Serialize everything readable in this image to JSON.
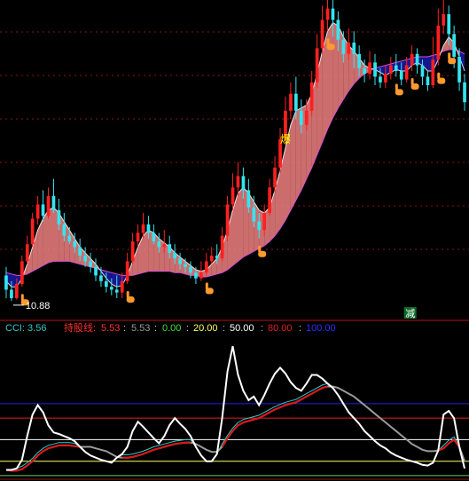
{
  "colors": {
    "background": "#000000",
    "up_candle": "#ff2020",
    "down_candle": "#33e5f0",
    "ribbon_up": "#f08080",
    "ribbon_down": "#1a1aa6",
    "ma_long": "#d94fd9",
    "ma_short": "#ffffff",
    "grid_red": "#8a1818",
    "separator": "#b01818",
    "cci": "#ffffff",
    "hold_line": "#e01414",
    "hold_grey": "#9a9a9a",
    "thin_cyan": "#33c8c8",
    "level_20": "#ffff66",
    "level_0": "#66cc66",
    "level_50": "#ffffff",
    "level_80": "#e02020",
    "level_100": "#2020ee",
    "hand": "#ff9a2e"
  },
  "main_panel": {
    "low_price_label": "10.88",
    "burst_label": "爆",
    "reduce_label": "减",
    "grid_rows": 6
  },
  "indicator_panel": {
    "cci_label": "CCI: 3.56",
    "hold_line_label": "持股线:",
    "hold_values": [
      "5.53",
      "5.53"
    ],
    "levels": [
      "0.00",
      "20.00",
      "50.00",
      "80.00",
      "100.00"
    ]
  },
  "chart_data": [
    {
      "type": "candlestick",
      "title": "",
      "low_marker_price": 10.88,
      "ylim": [
        10.5,
        21.5
      ],
      "candles": [
        [
          11.8,
          11.3,
          12.1,
          11.0
        ],
        [
          11.3,
          11.0,
          11.6,
          10.9
        ],
        [
          11.0,
          11.5,
          11.7,
          10.95
        ],
        [
          11.5,
          12.3,
          12.5,
          11.4
        ],
        [
          12.3,
          12.9,
          13.2,
          12.2
        ],
        [
          12.9,
          13.8,
          14.0,
          12.8
        ],
        [
          13.8,
          14.3,
          14.6,
          13.6
        ],
        [
          14.3,
          13.9,
          14.8,
          13.7
        ],
        [
          13.9,
          14.6,
          14.9,
          13.8
        ],
        [
          14.6,
          14.1,
          15.2,
          14.0
        ],
        [
          14.1,
          13.6,
          14.5,
          13.4
        ],
        [
          13.6,
          13.2,
          14.0,
          13.0
        ],
        [
          13.2,
          13.0,
          13.5,
          12.9
        ],
        [
          13.0,
          12.8,
          13.3,
          12.6
        ],
        [
          12.8,
          12.5,
          13.1,
          12.3
        ],
        [
          12.5,
          12.3,
          12.8,
          12.1
        ],
        [
          12.3,
          12.1,
          12.6,
          11.9
        ],
        [
          12.1,
          11.8,
          12.4,
          11.6
        ],
        [
          11.8,
          11.6,
          12.1,
          11.4
        ],
        [
          11.6,
          11.4,
          11.9,
          11.2
        ],
        [
          11.4,
          11.3,
          11.7,
          11.1
        ],
        [
          11.3,
          11.2,
          11.8,
          11.0
        ],
        [
          11.2,
          11.6,
          11.9,
          11.0
        ],
        [
          11.6,
          12.3,
          12.6,
          11.5
        ],
        [
          12.3,
          13.0,
          13.3,
          12.2
        ],
        [
          13.0,
          13.3,
          13.6,
          12.8
        ],
        [
          13.3,
          13.6,
          14.0,
          13.1
        ],
        [
          13.6,
          13.3,
          13.9,
          13.1
        ],
        [
          13.3,
          13.0,
          13.6,
          12.9
        ],
        [
          13.0,
          12.8,
          13.3,
          12.6
        ],
        [
          12.8,
          12.9,
          13.4,
          12.6
        ],
        [
          12.9,
          12.6,
          13.2,
          12.4
        ],
        [
          12.6,
          12.4,
          12.9,
          12.2
        ],
        [
          12.4,
          12.2,
          12.6,
          12.0
        ],
        [
          12.2,
          12.1,
          12.4,
          11.9
        ],
        [
          12.1,
          11.9,
          12.3,
          11.7
        ],
        [
          11.9,
          11.7,
          12.1,
          11.5
        ],
        [
          11.7,
          11.9,
          12.3,
          11.6
        ],
        [
          11.9,
          12.3,
          12.6,
          11.8
        ],
        [
          12.3,
          12.5,
          12.8,
          12.2
        ],
        [
          12.5,
          12.4,
          12.9,
          12.2
        ],
        [
          12.4,
          13.2,
          13.5,
          12.3
        ],
        [
          13.2,
          14.3,
          14.6,
          13.0
        ],
        [
          14.3,
          14.9,
          15.4,
          14.1
        ],
        [
          14.9,
          15.3,
          15.8,
          14.6
        ],
        [
          15.3,
          14.8,
          15.6,
          14.5
        ],
        [
          14.8,
          14.2,
          15.2,
          14.0
        ],
        [
          14.2,
          13.7,
          14.6,
          13.5
        ],
        [
          13.7,
          13.4,
          14.0,
          13.1
        ],
        [
          13.4,
          14.0,
          14.3,
          13.2
        ],
        [
          14.0,
          14.9,
          15.2,
          13.9
        ],
        [
          14.9,
          15.6,
          16.0,
          14.7
        ],
        [
          15.6,
          16.6,
          17.0,
          15.4
        ],
        [
          16.6,
          17.6,
          18.1,
          16.4
        ],
        [
          17.6,
          18.2,
          18.6,
          17.3
        ],
        [
          18.2,
          17.6,
          18.8,
          17.3
        ],
        [
          17.6,
          17.1,
          18.0,
          16.8
        ],
        [
          17.1,
          17.6,
          18.0,
          16.9
        ],
        [
          17.6,
          18.6,
          19.0,
          17.4
        ],
        [
          18.6,
          19.8,
          20.3,
          18.4
        ],
        [
          19.8,
          20.8,
          21.3,
          19.6
        ],
        [
          20.8,
          21.2,
          21.5,
          20.4
        ],
        [
          21.2,
          20.8,
          21.5,
          20.2
        ],
        [
          20.8,
          20.1,
          21.1,
          19.7
        ],
        [
          20.1,
          19.6,
          20.4,
          19.3
        ],
        [
          19.6,
          20.0,
          20.5,
          19.4
        ],
        [
          20.0,
          19.6,
          20.4,
          19.1
        ],
        [
          19.6,
          19.1,
          19.9,
          18.8
        ],
        [
          19.1,
          18.9,
          19.4,
          18.6
        ],
        [
          18.9,
          19.3,
          19.7,
          18.7
        ],
        [
          19.3,
          18.8,
          19.6,
          18.5
        ],
        [
          18.8,
          18.6,
          19.1,
          18.4
        ],
        [
          18.6,
          18.9,
          19.2,
          18.4
        ],
        [
          18.9,
          19.2,
          19.5,
          18.7
        ],
        [
          19.2,
          19.0,
          19.6,
          18.8
        ],
        [
          19.0,
          18.7,
          19.3,
          18.5
        ],
        [
          18.7,
          19.2,
          19.5,
          18.6
        ],
        [
          19.2,
          19.6,
          19.9,
          19.0
        ],
        [
          19.6,
          19.2,
          19.8,
          18.9
        ],
        [
          19.2,
          18.8,
          19.4,
          18.5
        ],
        [
          18.8,
          18.5,
          19.0,
          18.3
        ],
        [
          18.5,
          19.4,
          20.2,
          18.4
        ],
        [
          19.4,
          20.6,
          21.2,
          19.2
        ],
        [
          20.6,
          21.0,
          21.5,
          20.3
        ],
        [
          21.0,
          20.3,
          21.3,
          19.9
        ],
        [
          20.3,
          19.5,
          20.6,
          19.1
        ],
        [
          19.5,
          18.6,
          19.8,
          18.3
        ],
        [
          18.6,
          17.9,
          18.9,
          17.6
        ]
      ],
      "ma_long": [
        11.9,
        11.85,
        11.8,
        11.8,
        11.85,
        11.95,
        12.05,
        12.15,
        12.25,
        12.3,
        12.3,
        12.3,
        12.3,
        12.25,
        12.2,
        12.15,
        12.1,
        12.05,
        12.0,
        11.95,
        11.9,
        11.85,
        11.8,
        11.8,
        11.8,
        11.85,
        11.9,
        11.95,
        11.95,
        11.95,
        11.95,
        11.95,
        11.9,
        11.9,
        11.85,
        11.8,
        11.8,
        11.75,
        11.75,
        11.8,
        11.85,
        11.9,
        12.0,
        12.15,
        12.3,
        12.45,
        12.55,
        12.65,
        12.75,
        12.85,
        13.0,
        13.2,
        13.45,
        13.75,
        14.1,
        14.45,
        14.8,
        15.2,
        15.6,
        16.05,
        16.5,
        16.95,
        17.35,
        17.7,
        18.0,
        18.3,
        18.55,
        18.75,
        18.9,
        19.0,
        19.1,
        19.15,
        19.2,
        19.25,
        19.3,
        19.35,
        19.4,
        19.45,
        19.5,
        19.5,
        19.5,
        19.55,
        19.6,
        19.7,
        19.75,
        19.75,
        19.7,
        19.6
      ],
      "ma_short": [
        11.6,
        11.4,
        11.4,
        11.7,
        12.2,
        12.8,
        13.4,
        13.8,
        14.1,
        14.2,
        14.0,
        13.7,
        13.4,
        13.1,
        12.8,
        12.6,
        12.4,
        12.2,
        11.95,
        11.7,
        11.5,
        11.4,
        11.45,
        11.8,
        12.3,
        12.8,
        13.2,
        13.4,
        13.3,
        13.1,
        12.95,
        12.8,
        12.6,
        12.45,
        12.3,
        12.15,
        12.0,
        11.95,
        12.0,
        12.2,
        12.4,
        12.8,
        13.4,
        14.1,
        14.7,
        14.9,
        14.7,
        14.4,
        14.1,
        14.0,
        14.2,
        14.8,
        15.5,
        16.3,
        17.1,
        17.6,
        17.7,
        17.8,
        18.2,
        18.9,
        19.7,
        20.4,
        20.7,
        20.6,
        20.2,
        19.9,
        19.7,
        19.45,
        19.2,
        19.1,
        19.05,
        18.95,
        18.85,
        18.95,
        19.05,
        19.0,
        19.0,
        19.2,
        19.3,
        19.2,
        19.0,
        19.0,
        19.4,
        19.9,
        20.2,
        20.0,
        19.5,
        19.0
      ],
      "hand_marks": [
        3,
        23,
        38,
        48,
        61,
        74,
        77,
        82,
        84
      ],
      "burst_mark": 53,
      "reduce_mark": 76
    },
    {
      "type": "line",
      "title": "",
      "ylim": [
        -5,
        190
      ],
      "levels": [
        0,
        20,
        50,
        80,
        100
      ],
      "series": [
        {
          "name": "CCI",
          "values": [
            8,
            8,
            10,
            22,
            55,
            85,
            98,
            88,
            70,
            60,
            58,
            55,
            52,
            48,
            40,
            33,
            28,
            25,
            22,
            20,
            18,
            25,
            30,
            40,
            62,
            75,
            68,
            60,
            52,
            45,
            55,
            70,
            80,
            72,
            65,
            55,
            40,
            28,
            20,
            20,
            30,
            80,
            145,
            180,
            140,
            118,
            105,
            110,
            98,
            112,
            128,
            142,
            150,
            142,
            130,
            122,
            118,
            128,
            140,
            140,
            135,
            128,
            122,
            112,
            100,
            88,
            80,
            72,
            62,
            55,
            48,
            42,
            38,
            32,
            28,
            25,
            22,
            20,
            18,
            15,
            14,
            18,
            35,
            85,
            90,
            80,
            40,
            10
          ]
        },
        {
          "name": "持股线",
          "values": [
            8,
            7,
            7,
            9,
            14,
            20,
            28,
            34,
            38,
            40,
            42,
            42,
            42,
            41,
            40,
            40,
            40,
            38,
            36,
            34,
            30,
            26,
            25,
            25,
            26,
            28,
            30,
            33,
            36,
            38,
            40,
            42,
            44,
            45,
            46,
            46,
            44,
            40,
            36,
            33,
            33,
            40,
            52,
            62,
            70,
            74,
            76,
            78,
            80,
            84,
            88,
            92,
            95,
            98,
            100,
            102,
            106,
            110,
            114,
            118,
            122,
            124,
            124,
            122,
            118,
            114,
            110,
            104,
            98,
            92,
            86,
            80,
            74,
            68,
            62,
            56,
            50,
            44,
            40,
            36,
            34,
            34,
            35,
            38,
            45,
            50,
            40,
            20
          ]
        }
      ]
    }
  ]
}
